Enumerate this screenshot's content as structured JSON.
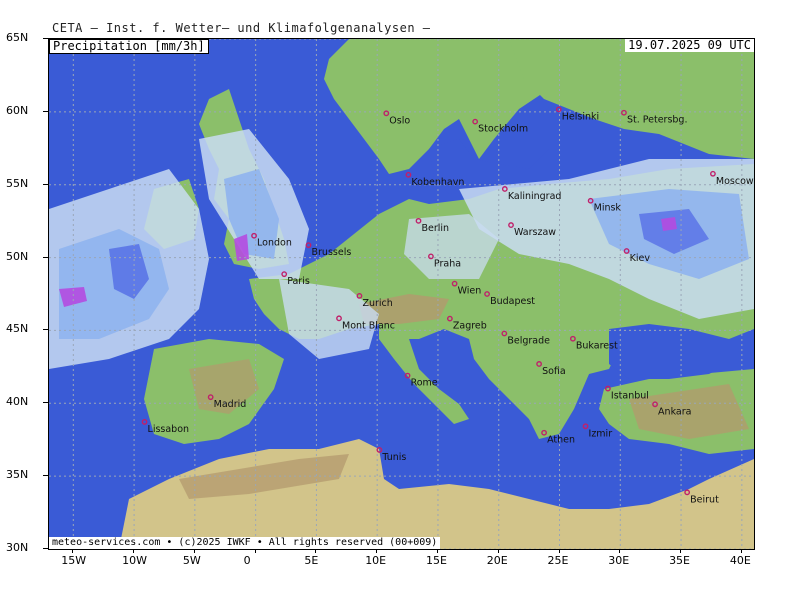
{
  "header": {
    "title": "CETA — Inst. f. Wetter— und Klimafolgenanalysen —"
  },
  "map": {
    "layer": "Precipitation [mm/3h]",
    "timestamp": "19.07.2025 09 UTC",
    "copyright": "meteo-services.com • (c)2025 IWKF • All rights reserved (00+009)",
    "lon_range": [
      -17,
      41
    ],
    "lat_range": [
      30,
      65
    ],
    "colors": {
      "sea": "#3a5bd6",
      "land": "#8bbf6a",
      "mountain": "#b39a6e",
      "desert": "#d2c48a",
      "rain_light": "#c9dcf2",
      "rain_mid": "#8fb4ee",
      "rain_heavy": "#5a74e6",
      "rain_extreme": "#b44be0"
    },
    "lon_ticks": [
      {
        "lon": -15,
        "label": "15W"
      },
      {
        "lon": -10,
        "label": "10W"
      },
      {
        "lon": -5,
        "label": "5W"
      },
      {
        "lon": 0,
        "label": "0"
      },
      {
        "lon": 5,
        "label": "5E"
      },
      {
        "lon": 10,
        "label": "10E"
      },
      {
        "lon": 15,
        "label": "15E"
      },
      {
        "lon": 20,
        "label": "20E"
      },
      {
        "lon": 25,
        "label": "25E"
      },
      {
        "lon": 30,
        "label": "30E"
      },
      {
        "lon": 35,
        "label": "35E"
      },
      {
        "lon": 40,
        "label": "40E"
      }
    ],
    "lat_ticks": [
      {
        "lat": 65,
        "label": "65N"
      },
      {
        "lat": 60,
        "label": "60N"
      },
      {
        "lat": 55,
        "label": "55N"
      },
      {
        "lat": 50,
        "label": "50N"
      },
      {
        "lat": 45,
        "label": "45N"
      },
      {
        "lat": 40,
        "label": "40N"
      },
      {
        "lat": 35,
        "label": "35N"
      },
      {
        "lat": 30,
        "label": "30N"
      }
    ],
    "cities": [
      {
        "name": "Oslo",
        "lon": 10.75,
        "lat": 59.9
      },
      {
        "name": "Stockholm",
        "lon": 18.06,
        "lat": 59.33
      },
      {
        "name": "Helsinki",
        "lon": 24.94,
        "lat": 60.17
      },
      {
        "name": "St. Petersbg.",
        "lon": 30.3,
        "lat": 59.94
      },
      {
        "name": "Kobenhavn",
        "lon": 12.57,
        "lat": 55.68
      },
      {
        "name": "Kaliningrad",
        "lon": 20.5,
        "lat": 54.71
      },
      {
        "name": "Minsk",
        "lon": 27.56,
        "lat": 53.9
      },
      {
        "name": "Moscow",
        "lon": 37.62,
        "lat": 55.75
      },
      {
        "name": "London",
        "lon": -0.13,
        "lat": 51.5
      },
      {
        "name": "Berlin",
        "lon": 13.4,
        "lat": 52.52
      },
      {
        "name": "Warszaw",
        "lon": 21.01,
        "lat": 52.23
      },
      {
        "name": "Brussels",
        "lon": 4.35,
        "lat": 50.85
      },
      {
        "name": "Praha",
        "lon": 14.42,
        "lat": 50.08
      },
      {
        "name": "Kiev",
        "lon": 30.52,
        "lat": 50.45
      },
      {
        "name": "Paris",
        "lon": 2.35,
        "lat": 48.86
      },
      {
        "name": "Wien",
        "lon": 16.37,
        "lat": 48.21
      },
      {
        "name": "Zurich",
        "lon": 8.54,
        "lat": 47.37
      },
      {
        "name": "Budapest",
        "lon": 19.04,
        "lat": 47.5
      },
      {
        "name": "Mont Blanc",
        "lon": 6.86,
        "lat": 45.83
      },
      {
        "name": "Zagreb",
        "lon": 15.98,
        "lat": 45.81
      },
      {
        "name": "Belgrade",
        "lon": 20.46,
        "lat": 44.79
      },
      {
        "name": "Bukarest",
        "lon": 26.1,
        "lat": 44.43
      },
      {
        "name": "Sofia",
        "lon": 23.32,
        "lat": 42.7
      },
      {
        "name": "Rome",
        "lon": 12.5,
        "lat": 41.9
      },
      {
        "name": "Istanbul",
        "lon": 28.98,
        "lat": 41.01
      },
      {
        "name": "Madrid",
        "lon": -3.7,
        "lat": 40.42
      },
      {
        "name": "Ankara",
        "lon": 32.86,
        "lat": 39.93
      },
      {
        "name": "Lissabon",
        "lon": -9.14,
        "lat": 38.72
      },
      {
        "name": "Athen",
        "lon": 23.73,
        "lat": 37.98
      },
      {
        "name": "Izmir",
        "lon": 27.14,
        "lat": 38.42
      },
      {
        "name": "Tunis",
        "lon": 10.18,
        "lat": 36.8
      },
      {
        "name": "Beirut",
        "lon": 35.5,
        "lat": 33.89
      }
    ]
  }
}
